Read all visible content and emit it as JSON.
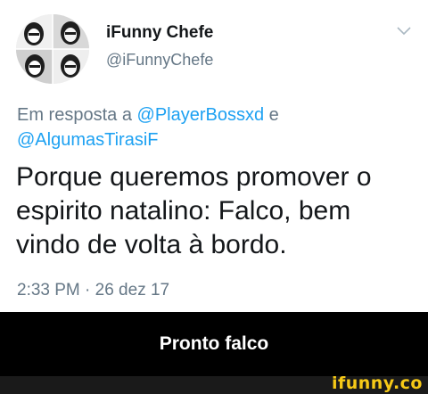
{
  "tweet": {
    "author_name": "iFunny Chefe",
    "author_handle": "@iFunnyChefe",
    "reply_prefix": "Em resposta a ",
    "reply_mention_1": "@PlayerBossxd",
    "reply_joiner": " e",
    "reply_mention_2": "@AlgumasTirasiF",
    "text_line_1": "Porque queremos promover o",
    "text_line_2": "espirito natalino: Falco, bem",
    "text_line_3": "vindo de volta à bordo.",
    "timestamp": "2:33 PM · 26 dez 17",
    "mention_color": "#1da1f2",
    "menu_icon": "chevron-down-icon"
  },
  "caption": {
    "text": "Pronto falco"
  },
  "footer": {
    "watermark": "ifunny.co",
    "watermark_color": "#f6c917"
  }
}
